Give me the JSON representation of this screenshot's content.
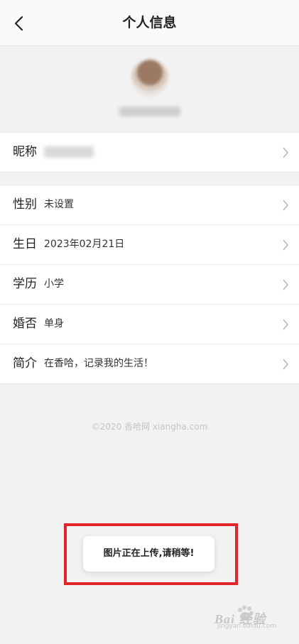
{
  "header": {
    "title": "个人信息"
  },
  "profile_rows": [
    {
      "label": "昵称",
      "value": ""
    }
  ],
  "detail_rows": [
    {
      "label": "性别",
      "value": "未设置"
    },
    {
      "label": "生日",
      "value": "2023年02月21日"
    },
    {
      "label": "学历",
      "value": "小学"
    },
    {
      "label": "婚否",
      "value": "单身"
    },
    {
      "label": "简介",
      "value": "在香哈，记录我的生活！"
    }
  ],
  "footer": {
    "copyright": "©2020 香哈网 xiangha.com"
  },
  "toast": {
    "message": "图片正在上传,请稍等!"
  },
  "watermark": {
    "main": "Bai 经验",
    "sub": "jingyan.baidu.com"
  },
  "colors": {
    "highlight": "#e0242b",
    "background": "#f2f2f2"
  },
  "icons": {
    "back": "back-arrow-icon",
    "row_arrow": "chevron-right-icon"
  }
}
